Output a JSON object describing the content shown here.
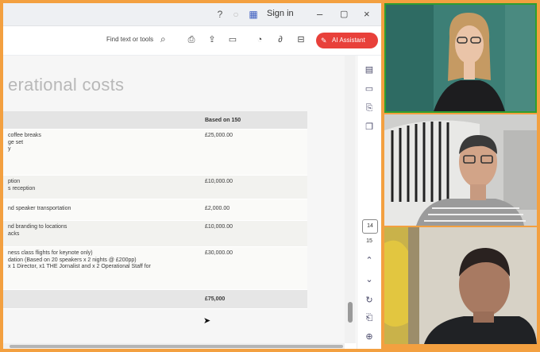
{
  "toolbar": {
    "sign_in": "Sign in",
    "find_placeholder": "Find text or tools",
    "ai_assistant": "AI Assistant",
    "ai_color": "#e8403a"
  },
  "document": {
    "title": "erational costs",
    "table": {
      "header": {
        "col2": "Based on 150"
      },
      "rows": [
        {
          "col1": "coffee breaks\nge set\ny",
          "col2": "£25,000.00"
        },
        {
          "col1": "ption\ns reception",
          "col2": "£10,000.00"
        },
        {
          "col1": "nd speaker transportation",
          "col2": "£2,000.00"
        },
        {
          "col1": "nd branding to locations\nacks",
          "col2": "£10,000.00"
        },
        {
          "col1": "ness class flights for keynote only)\ndation (Based on 20 speakers x 2 nights @ £200pp)\nx 1 Director, x1 THE Jornalist and x 2 Operational Staff for",
          "col2": "£30,000.00"
        }
      ],
      "total": {
        "col2": "£75,000"
      }
    }
  },
  "navigation": {
    "current_page": "14",
    "total_pages": "15"
  },
  "video_tiles": {
    "active_speaker_border": "#2f9e2f"
  }
}
